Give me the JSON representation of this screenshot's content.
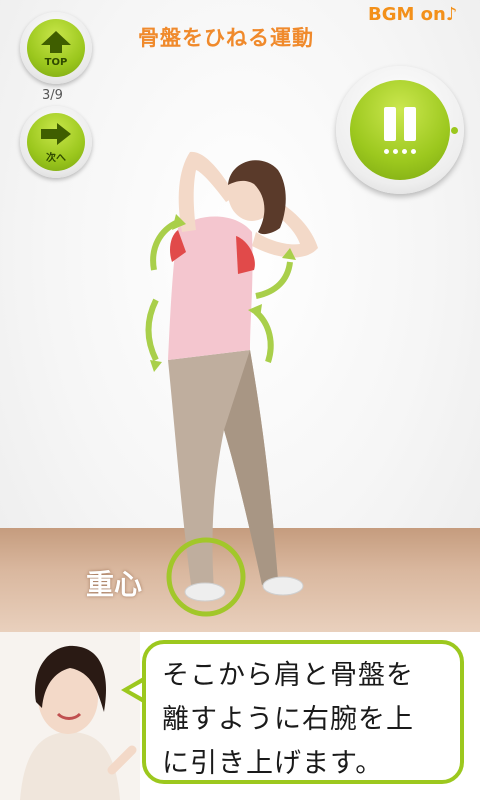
{
  "header": {
    "title": "骨盤をひねる運動",
    "bgm_label": "BGM on♪"
  },
  "nav": {
    "top_label": "TOP",
    "next_label": "次へ",
    "step_counter": "3/9"
  },
  "exercise": {
    "center_label": "重心",
    "instruction": "そこから肩と骨盤を離すように右腕を上に引き上げます。",
    "instruction_lines": [
      "そこから肩と骨盤を",
      "離すように右腕を上",
      "に引き上げます。"
    ]
  },
  "colors": {
    "accent_green": "#9bc71d",
    "title_orange": "#f08a2c",
    "floor_brown": "#c59c7e"
  },
  "icons": {
    "top": "arrow-up-icon",
    "next": "arrow-right-icon",
    "pause": "pause-icon"
  }
}
